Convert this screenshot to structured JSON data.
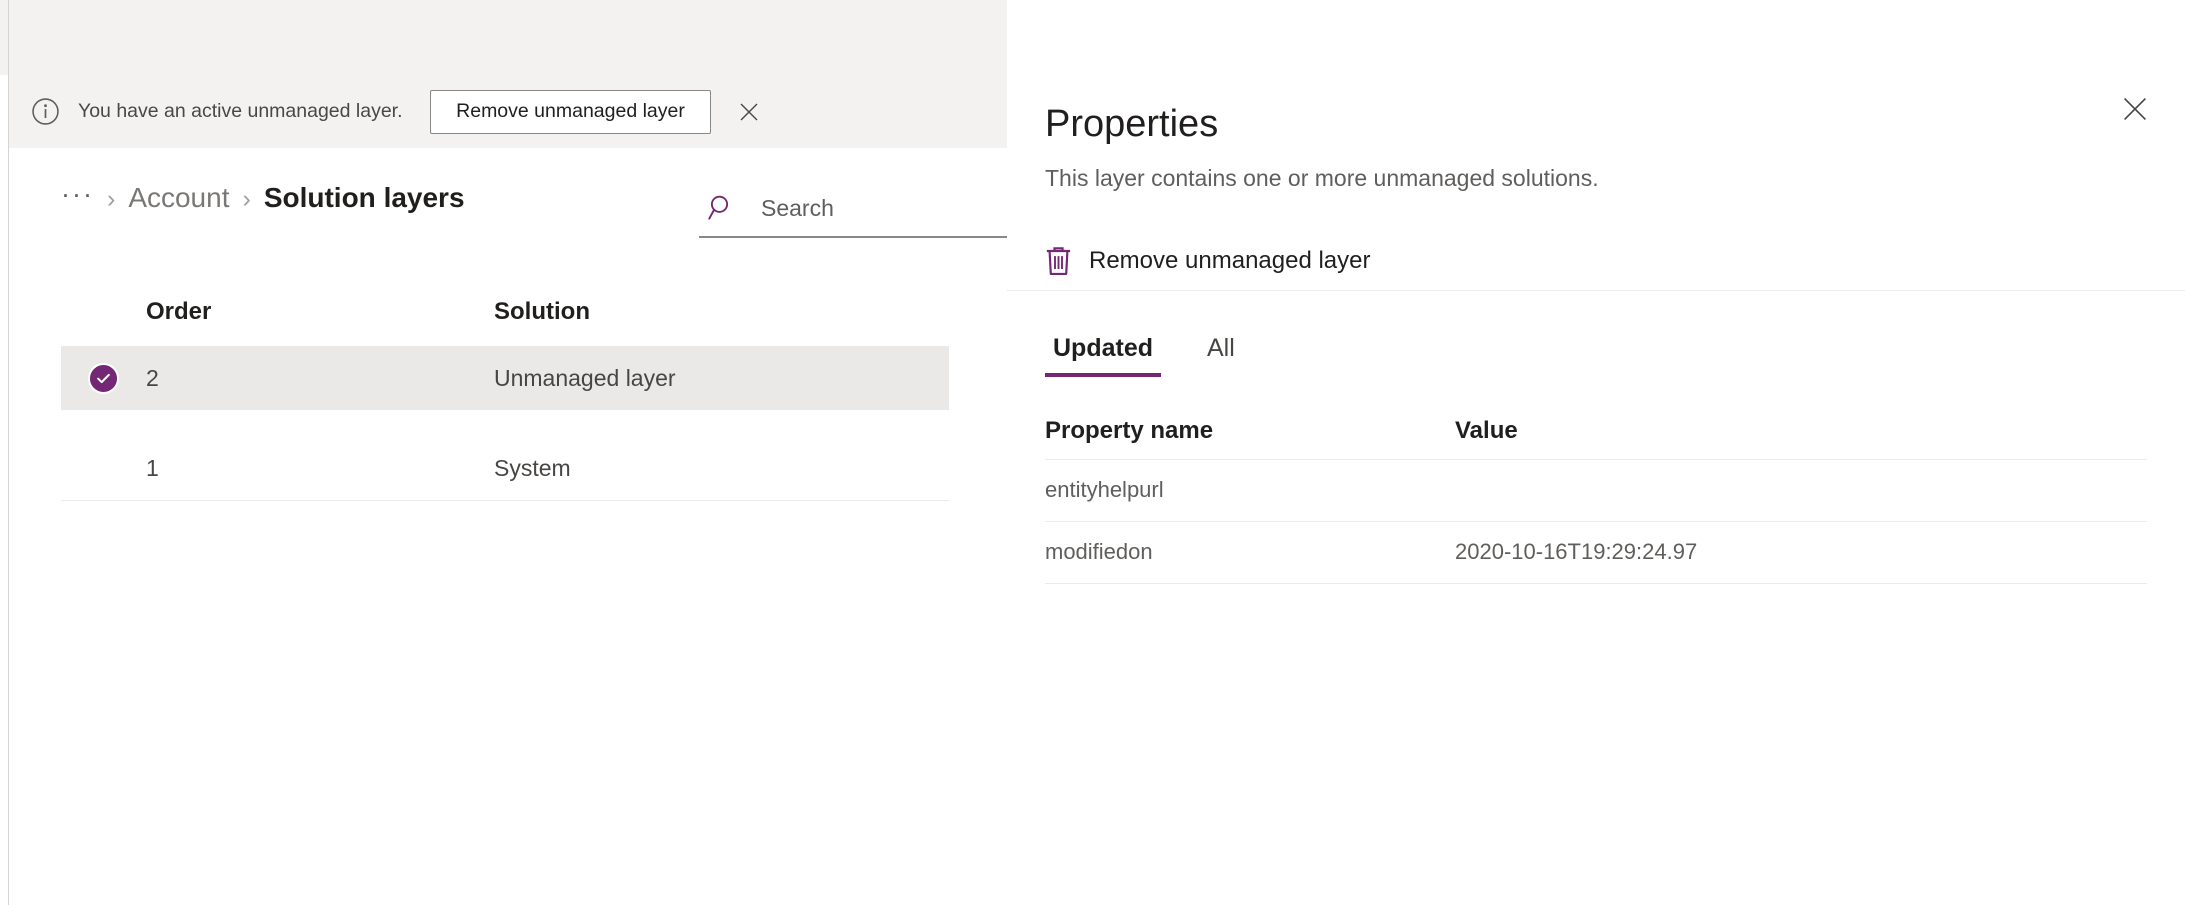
{
  "message_bar": {
    "icon": "info-circle-icon",
    "text": "You have an active unmanaged layer. Th...",
    "action_label": "Remove unmanaged layer",
    "close_icon": "close-icon"
  },
  "breadcrumb": {
    "ellipsis": "···",
    "separator": "›",
    "parent": "Account",
    "current": "Solution layers"
  },
  "search": {
    "icon": "search-icon",
    "placeholder": "Search",
    "value": ""
  },
  "layers_grid": {
    "columns": [
      "Order",
      "Solution"
    ],
    "rows": [
      {
        "order": "2",
        "solution": "Unmanaged layer",
        "selected": true
      },
      {
        "order": "1",
        "solution": "System",
        "selected": false
      }
    ]
  },
  "panel": {
    "title": "Properties",
    "subtitle": "This layer contains one or more unmanaged solutions.",
    "close_icon": "close-icon",
    "command": {
      "icon": "trash-icon",
      "label": "Remove unmanaged layer"
    },
    "tabs": [
      {
        "label": "Updated",
        "active": true
      },
      {
        "label": "All",
        "active": false
      }
    ],
    "properties_table": {
      "columns": [
        "Property name",
        "Value"
      ],
      "rows": [
        {
          "name": "entityhelpurl",
          "value": ""
        },
        {
          "name": "modifiedon",
          "value": "2020-10-16T19:29:24.97"
        }
      ]
    }
  },
  "colors": {
    "accent": "#742774",
    "chrome_bg": "#f3f2f1",
    "row_selected_bg": "#ebe9e7",
    "divider": "#edebe9",
    "text_primary": "#201f1e",
    "text_secondary": "#605e5c"
  }
}
